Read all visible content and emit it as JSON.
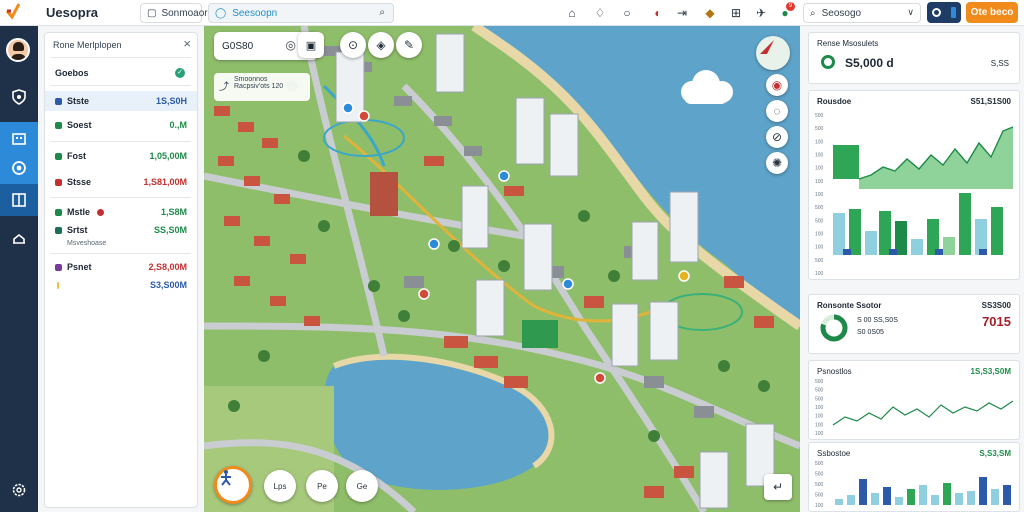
{
  "app": {
    "title": "Uesopra"
  },
  "topbar": {
    "search_label": "Sonmoaore",
    "address_text": "Seesoopn",
    "select_label": "Seosogo",
    "primary_button": "Ote beco",
    "notification_badge": "9"
  },
  "left_panel": {
    "title": "Rone Merlplopen",
    "close": "×",
    "rows": [
      {
        "label": "Goebos",
        "value": "",
        "color": "#1e8a4a",
        "sub": ""
      },
      {
        "label": "Stste",
        "value": "1S,S0H",
        "color": "#2c5aa8",
        "sub": ""
      },
      {
        "label": "Soest",
        "value": "0.,M",
        "color": "#1e8a4a",
        "sub": ""
      },
      {
        "label": "Fost",
        "value": "1,05,00M",
        "color": "#1e8a4a",
        "sub": ""
      },
      {
        "label": "Stsse",
        "value": "1,S81,00M",
        "color": "#c23030",
        "sub": ""
      },
      {
        "label": "Mstle",
        "value": "1,S8M",
        "color": "#1e8a4a",
        "sub": ""
      },
      {
        "label": "Srtst",
        "value": "SS,S0M",
        "color": "#1e8a4a",
        "sub": "Msveshoase"
      },
      {
        "label": "Psnet",
        "value": "2,S8,00M",
        "color": "#c23030",
        "sub": ""
      },
      {
        "label": "",
        "value": "S3,S00M",
        "color": "#f0c23a",
        "sub": ""
      }
    ]
  },
  "map": {
    "search_text": "G0S80",
    "info_line1": "Smoonnos",
    "info_line2": "Racpsiv'ots 120",
    "bottom_controls": [
      "Lps",
      "Pe",
      "Ge"
    ]
  },
  "right_panel": {
    "summary": {
      "title": "Rense Msosulets",
      "value": "S5,000 d",
      "side": "S,SS"
    },
    "chart1": {
      "title": "Rousdoe",
      "value": "S51,S1S00",
      "y_ticks": [
        "500",
        "500",
        "100",
        "100",
        "100",
        "100",
        "100",
        "500",
        "500",
        "100",
        "100",
        "500",
        "100"
      ]
    },
    "donut": {
      "title": "Ronsonte Ssotor",
      "value": "SS3S00",
      "line1": "S 00 SS,S0S",
      "line2": "S0 0S05",
      "big": "7015"
    },
    "chart2": {
      "title": "Psnostlos",
      "value": "1S,S3,S0M",
      "y_ticks": [
        "500",
        "500",
        "500",
        "100",
        "100",
        "100",
        "100"
      ]
    },
    "chart3": {
      "title": "Ssbostoe",
      "value": "S,S3,SM",
      "y_ticks": [
        "500",
        "500",
        "500",
        "500",
        "100"
      ]
    }
  },
  "colors": {
    "accent": "#2c8ad8",
    "positive": "#1e8a4a",
    "negative": "#c23030",
    "orange": "#f08b1c",
    "rail": "#1f3148"
  }
}
